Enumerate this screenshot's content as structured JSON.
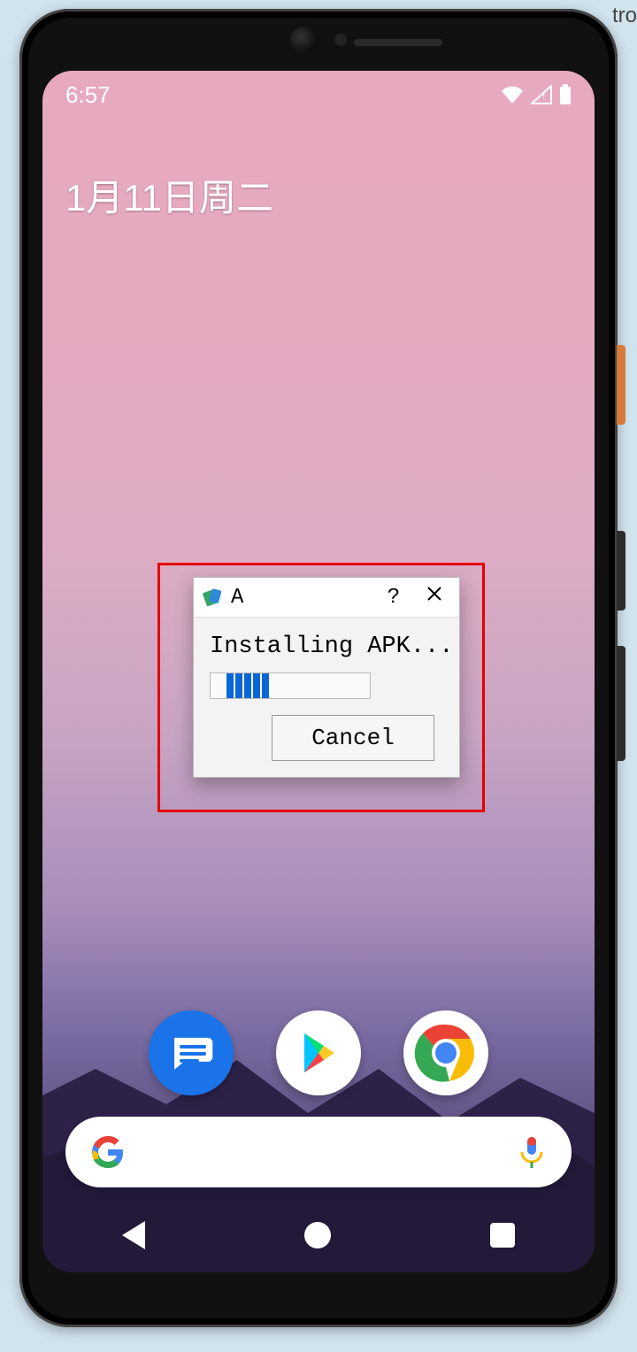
{
  "background_text_fragment": "tro",
  "status_bar": {
    "time": "6:57"
  },
  "home": {
    "date_text": "1月11日周二"
  },
  "dock": {
    "messages_label": "Messages",
    "play_label": "Play Store",
    "chrome_label": "Chrome"
  },
  "search": {
    "placeholder": ""
  },
  "nav": {
    "back": "Back",
    "home": "Home",
    "recents": "Recents"
  },
  "dialog": {
    "title_short": "A",
    "help_label": "?",
    "close_label": "×",
    "message": "Installing APK...",
    "cancel_label": "Cancel",
    "progress_percent": 25
  }
}
